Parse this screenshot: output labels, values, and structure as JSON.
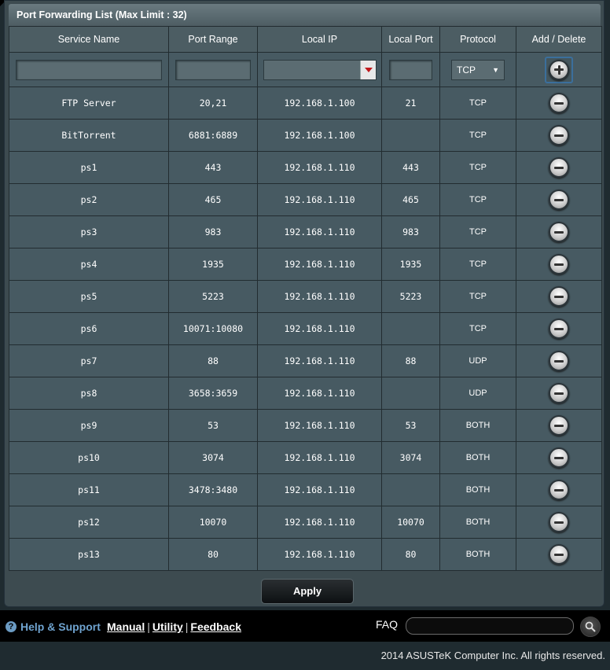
{
  "list": {
    "title": "Port Forwarding List (Max Limit : 32)"
  },
  "columns": [
    "Service Name",
    "Port Range",
    "Local IP",
    "Local Port",
    "Protocol",
    "Add / Delete"
  ],
  "input_row": {
    "service_name": "",
    "port_range": "",
    "local_ip": "",
    "local_port": "",
    "protocol": "TCP",
    "protocol_options": [
      "TCP"
    ]
  },
  "rules": [
    {
      "name": "FTP Server",
      "range": "20,21",
      "ip": "192.168.1.100",
      "port": "21",
      "proto": "TCP"
    },
    {
      "name": "BitTorrent",
      "range": "6881:6889",
      "ip": "192.168.1.100",
      "port": "",
      "proto": "TCP"
    },
    {
      "name": "ps1",
      "range": "443",
      "ip": "192.168.1.110",
      "port": "443",
      "proto": "TCP"
    },
    {
      "name": "ps2",
      "range": "465",
      "ip": "192.168.1.110",
      "port": "465",
      "proto": "TCP"
    },
    {
      "name": "ps3",
      "range": "983",
      "ip": "192.168.1.110",
      "port": "983",
      "proto": "TCP"
    },
    {
      "name": "ps4",
      "range": "1935",
      "ip": "192.168.1.110",
      "port": "1935",
      "proto": "TCP"
    },
    {
      "name": "ps5",
      "range": "5223",
      "ip": "192.168.1.110",
      "port": "5223",
      "proto": "TCP"
    },
    {
      "name": "ps6",
      "range": "10071:10080",
      "ip": "192.168.1.110",
      "port": "",
      "proto": "TCP"
    },
    {
      "name": "ps7",
      "range": "88",
      "ip": "192.168.1.110",
      "port": "88",
      "proto": "UDP"
    },
    {
      "name": "ps8",
      "range": "3658:3659",
      "ip": "192.168.1.110",
      "port": "",
      "proto": "UDP"
    },
    {
      "name": "ps9",
      "range": "53",
      "ip": "192.168.1.110",
      "port": "53",
      "proto": "BOTH"
    },
    {
      "name": "ps10",
      "range": "3074",
      "ip": "192.168.1.110",
      "port": "3074",
      "proto": "BOTH"
    },
    {
      "name": "ps11",
      "range": "3478:3480",
      "ip": "192.168.1.110",
      "port": "",
      "proto": "BOTH"
    },
    {
      "name": "ps12",
      "range": "10070",
      "ip": "192.168.1.110",
      "port": "10070",
      "proto": "BOTH"
    },
    {
      "name": "ps13",
      "range": "80",
      "ip": "192.168.1.110",
      "port": "80",
      "proto": "BOTH"
    }
  ],
  "apply_label": "Apply",
  "bottom": {
    "help_icon": "?",
    "help_label": "Help & Support",
    "links": [
      "Manual",
      "Utility",
      "Feedback"
    ],
    "link_separator": "|",
    "faq_label": "FAQ",
    "faq_value": ""
  },
  "footer": {
    "copyright": "2014 ASUSTeK Computer Inc. All rights reserved."
  },
  "icons": {
    "add": "plus-circle-icon",
    "delete": "minus-circle-icon",
    "search": "search-icon",
    "help": "help-icon",
    "dropdown": "dropdown-arrow-icon"
  },
  "colors": {
    "panel": "#3d4b50",
    "row": "#475a62",
    "help_link": "#6fa3cf",
    "dropdown_arrow": "#c0191c",
    "add_border": "#3b6f9c"
  }
}
